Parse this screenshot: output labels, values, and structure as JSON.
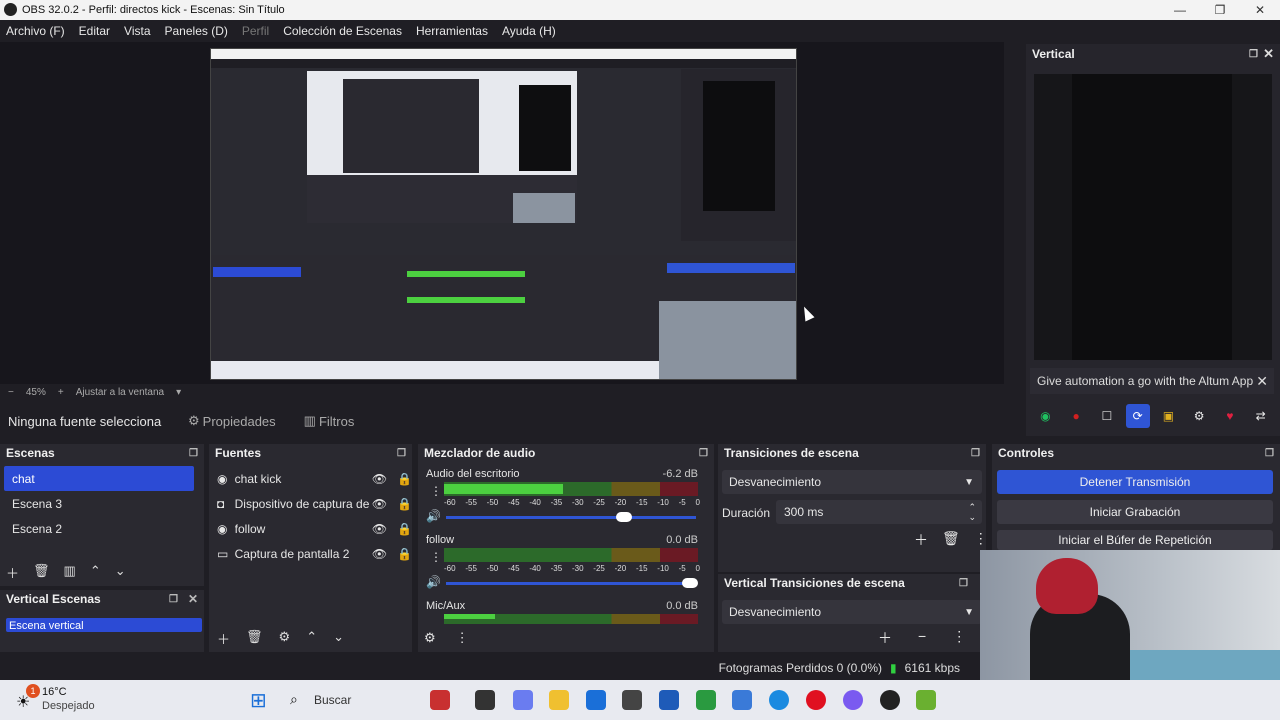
{
  "window": {
    "title": "OBS 32.0.2 - Perfil: directos kick - Escenas: Sin Título"
  },
  "menu": [
    {
      "label": "Archivo (F)",
      "enabled": true
    },
    {
      "label": "Editar",
      "enabled": true
    },
    {
      "label": "Vista",
      "enabled": true
    },
    {
      "label": "Paneles (D)",
      "enabled": true
    },
    {
      "label": "Perfil",
      "enabled": false
    },
    {
      "label": "Colección de Escenas",
      "enabled": true
    },
    {
      "label": "Herramientas",
      "enabled": true
    },
    {
      "label": "Ayuda (H)",
      "enabled": true
    }
  ],
  "preview": {
    "zoom_minus": "−",
    "zoom": "45%",
    "zoom_plus": "+",
    "fit_label": "Ajustar a la ventana"
  },
  "vertical": {
    "title": "Vertical",
    "altum_text": "Give automation a go with the Altum App"
  },
  "source_bar": {
    "status": "Ninguna fuente selecciona",
    "properties": "Propiedades",
    "filters": "Filtros"
  },
  "scenes": {
    "title": "Escenas",
    "items": [
      {
        "label": "chat"
      },
      {
        "label": "Escena 3"
      },
      {
        "label": "Escena 2"
      }
    ],
    "selected": "chat"
  },
  "vertical_scenes": {
    "title": "Vertical Escenas",
    "items": [
      {
        "label": "Escena vertical"
      }
    ]
  },
  "sources": {
    "title": "Fuentes",
    "items": [
      {
        "label": "chat kick",
        "icon": "globe-icon"
      },
      {
        "label": "Dispositivo de captura de",
        "icon": "camera-icon"
      },
      {
        "label": "follow",
        "icon": "globe-icon"
      },
      {
        "label": "Captura de pantalla 2",
        "icon": "monitor-icon"
      }
    ]
  },
  "mixer": {
    "title": "Mezclador de audio",
    "ticks": [
      "-60",
      "-55",
      "-50",
      "-45",
      "-40",
      "-35",
      "-30",
      "-25",
      "-20",
      "-15",
      "-10",
      "-5",
      "0"
    ],
    "channels": [
      {
        "name": "Audio del escritorio",
        "db": "-6.2 dB",
        "level": 0.47,
        "volume": 0.72
      },
      {
        "name": "follow",
        "db": "0.0 dB",
        "level": 0.0,
        "volume": 1.0
      },
      {
        "name": "Mic/Aux",
        "db": "0.0 dB",
        "level": 0.2,
        "volume": 1.0
      }
    ]
  },
  "transitions": {
    "title": "Transiciones de escena",
    "type": "Desvanecimiento",
    "duration_label": "Duración",
    "duration": "300 ms"
  },
  "vertical_transitions": {
    "title": "Vertical Transiciones de escena",
    "type": "Desvanecimiento"
  },
  "controls": {
    "title": "Controles",
    "stop_stream": "Detener Transmisión",
    "start_recording": "Iniciar Grabación",
    "start_replay": "Iniciar el Búfer de Repetición"
  },
  "status": {
    "dropped": "Fotogramas Perdidos 0 (0.0%)",
    "bitrate": "6161 kbps"
  },
  "taskbar": {
    "weather_temp": "16°C",
    "weather_desc": "Despejado",
    "weather_badge": "1",
    "search": "Buscar"
  },
  "colors": {
    "accent": "#2f55d4",
    "panel": "#2a2930",
    "background": "#1f1e24",
    "meter_green": "#4cd040",
    "meter_yellow": "#c8b020",
    "meter_red": "#c82030"
  }
}
